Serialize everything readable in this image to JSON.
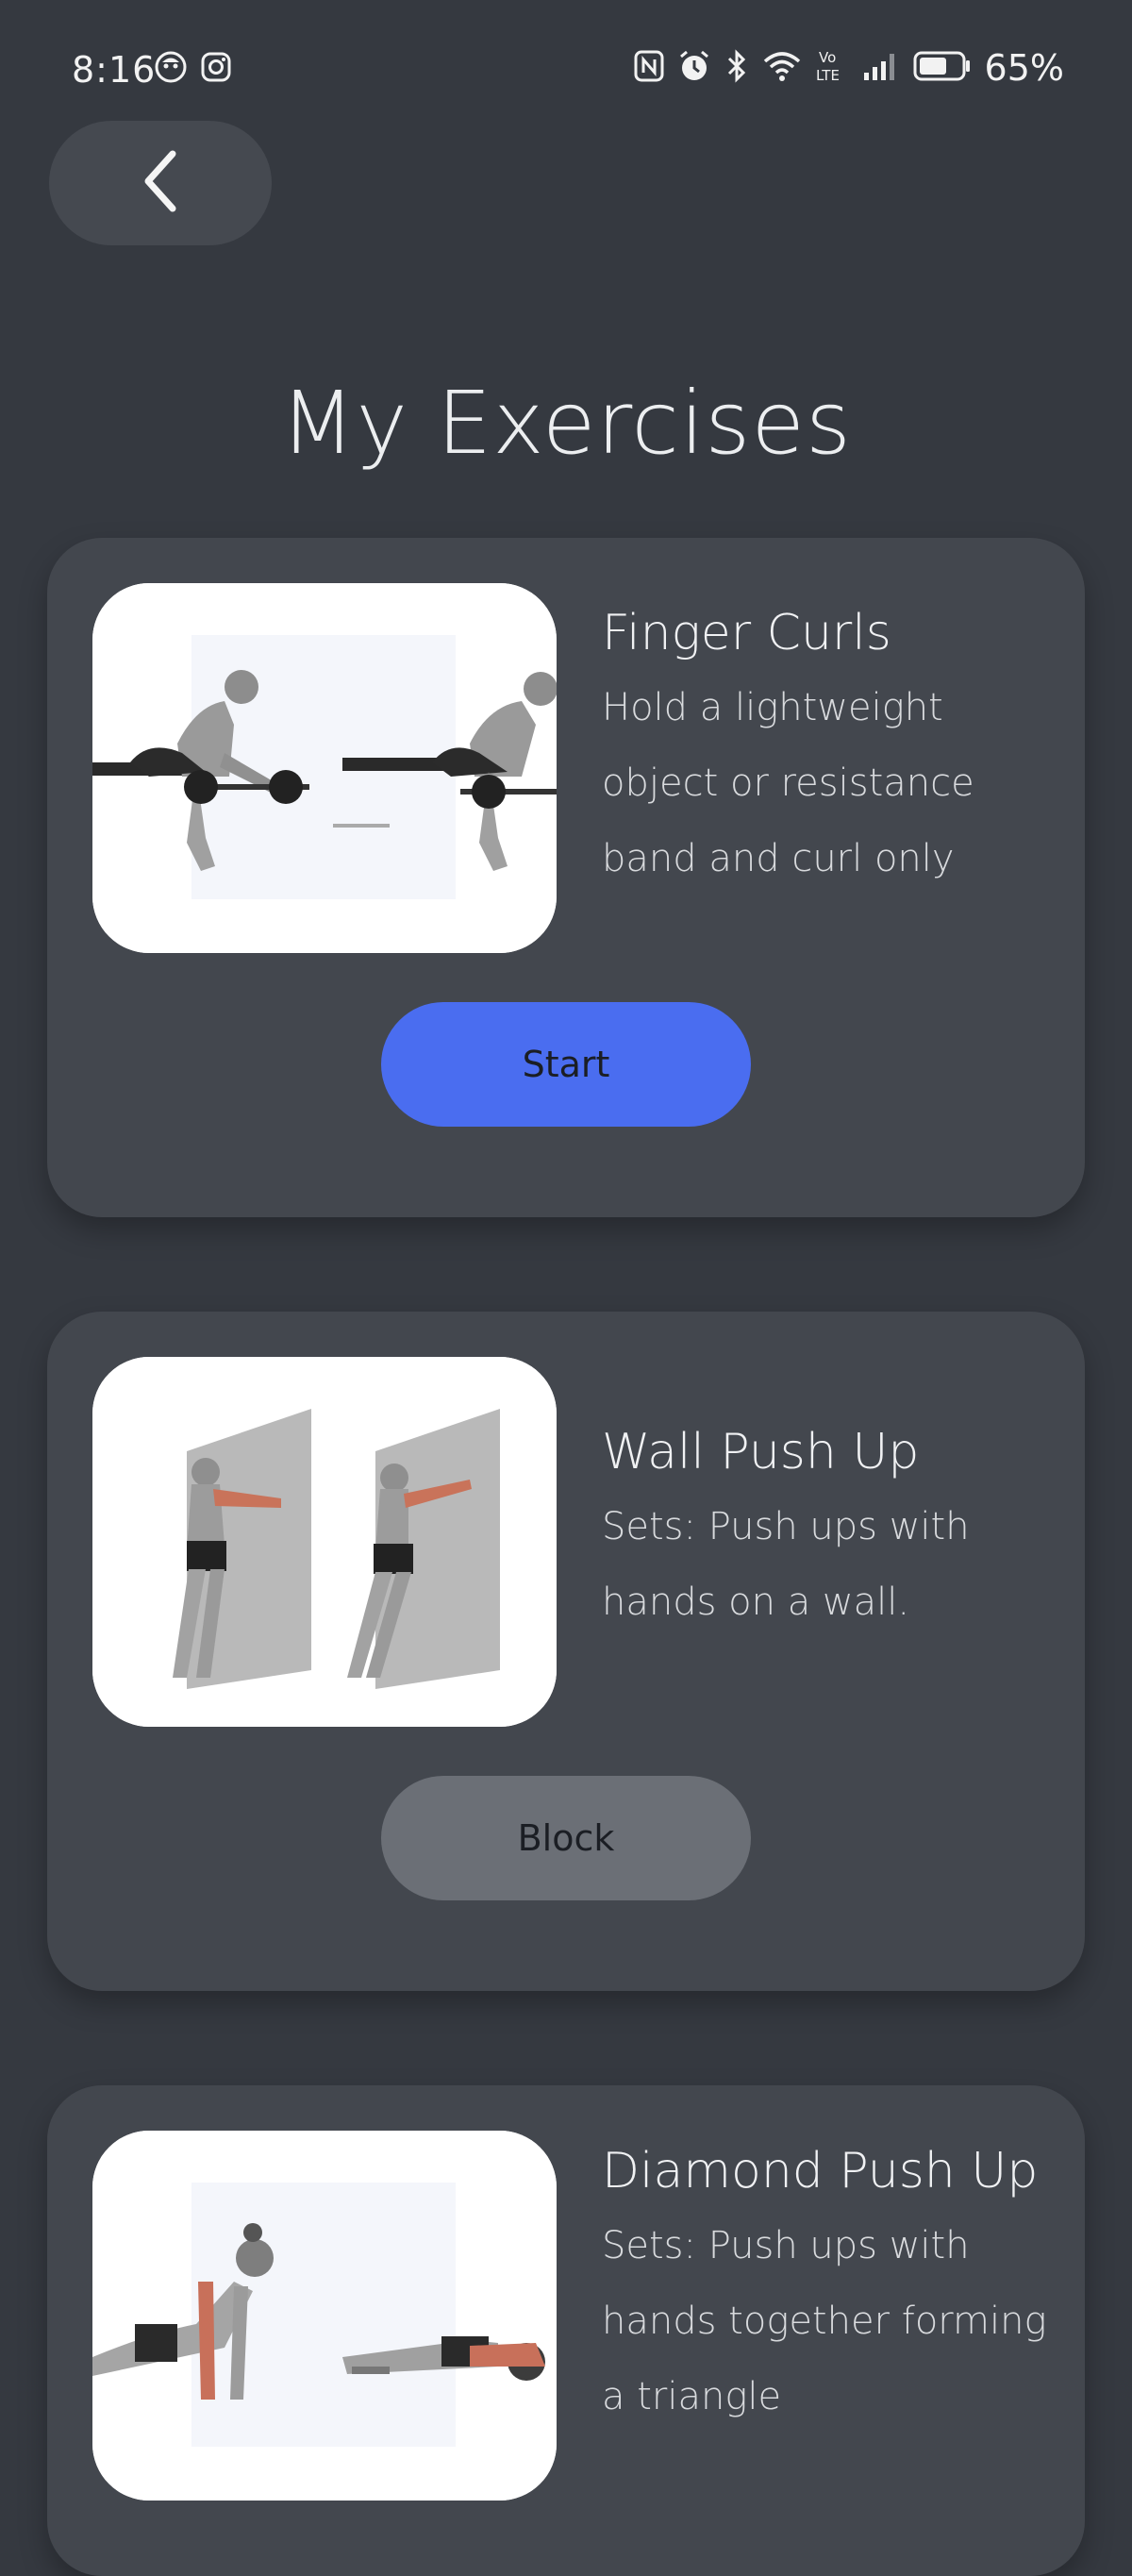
{
  "status_bar": {
    "time": "8:16",
    "battery_percent": "65%",
    "left_icons": [
      "face-icon",
      "instagram-icon"
    ],
    "right_icons": [
      "nfc-icon",
      "alarm-icon",
      "bluetooth-icon",
      "wifi-icon",
      "volte-icon",
      "signal-icon",
      "battery-icon"
    ],
    "volte_label": "Vo LTE"
  },
  "header": {
    "back_icon": "chevron-left-icon",
    "title": "My Exercises"
  },
  "exercises": [
    {
      "title": "Finger Curls",
      "description": "Hold a lightweight object or resistance band and curl only",
      "button_label": "Start",
      "button_state": "active"
    },
    {
      "title": "Wall Push Up",
      "description": "Sets: Push ups with hands on a wall.",
      "button_label": "Block",
      "button_state": "blocked"
    },
    {
      "title": "Diamond Push Up",
      "description": "Sets: Push ups with hands together forming a triangle",
      "button_label": "",
      "button_state": ""
    }
  ],
  "colors": {
    "background": "#353940",
    "card": "#43474e",
    "start_button": "#4a6df0",
    "block_button": "#6b6f76"
  }
}
